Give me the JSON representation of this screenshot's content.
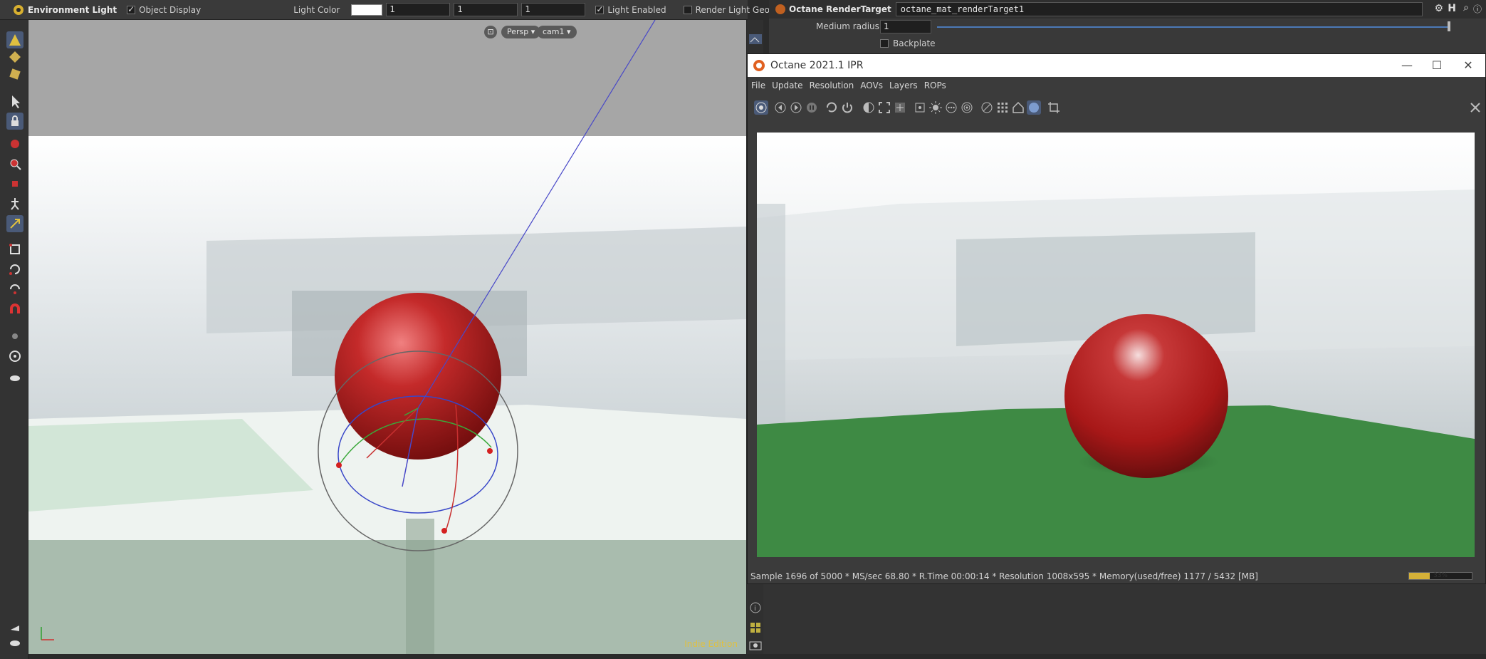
{
  "toolbar": {
    "node_label": "Environment Light",
    "object_display_label": "Object Display",
    "object_display_checked": true,
    "light_color_label": "Light Color",
    "light_color_value": "#ffffff",
    "light_color_r": "1",
    "light_color_g": "1",
    "light_color_b": "1",
    "light_enabled_label": "Light Enabled",
    "light_enabled_checked": true,
    "render_light_geometry_label": "Render Light Geometry",
    "render_light_geometry_checked": false
  },
  "viewport": {
    "persp_label": "Persp ▾",
    "camera_label": "cam1 ▾",
    "indie_label": "Indie Edition"
  },
  "params": {
    "node_type": "Octane RenderTarget",
    "node_name": "octane_mat_renderTarget1",
    "medium_radius_label": "Medium radius",
    "medium_radius_value": "1",
    "backplate_label": "Backplate",
    "backplate_checked": false
  },
  "ipr": {
    "title": "Octane 2021.1 IPR",
    "menu": [
      "File",
      "Update",
      "Resolution",
      "AOVs",
      "Layers",
      "ROPs"
    ],
    "status": "Sample 1696 of 5000 * MS/sec 68.80 * R.Time 00:00:14 * Resolution 1008x595 * Memory(used/free) 1177 / 5432 [MB]",
    "progress_percent": 33,
    "progress_label": "33%"
  },
  "colors": {
    "accent": "#4a5a78",
    "ball_red": "#b81c1c",
    "floor_green": "#3e8a44",
    "progress": "#d4b038",
    "indie": "#e0c040"
  }
}
